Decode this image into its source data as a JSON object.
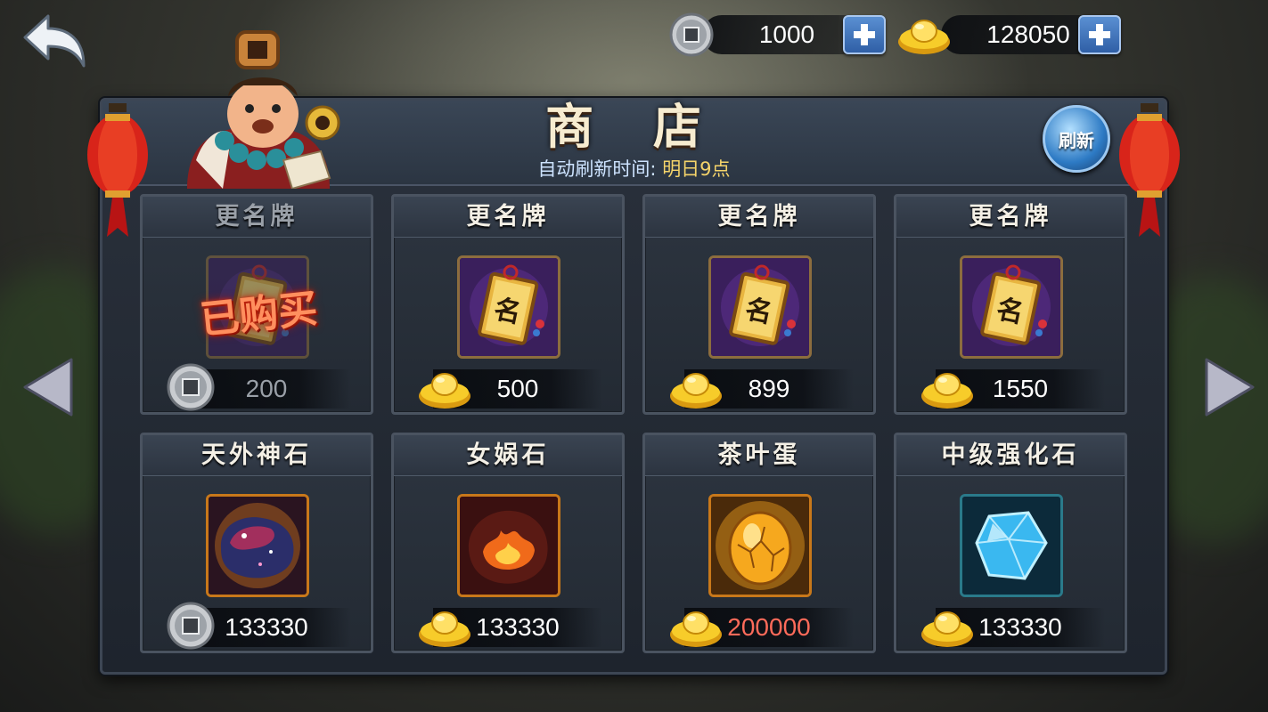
{
  "currency": {
    "coin": {
      "icon": "copper-coin-icon",
      "value": "1000"
    },
    "gold": {
      "icon": "gold-ingot-icon",
      "value": "128050"
    }
  },
  "shop": {
    "title": "商 店",
    "refresh_prefix": "自动刷新时间:",
    "refresh_time": "明日9点",
    "refresh_button": "刷新",
    "sold_label": "已购买"
  },
  "items": [
    {
      "name": "更名牌",
      "icon": "name-plate-icon",
      "currency": "coin",
      "price": "200",
      "sold": true
    },
    {
      "name": "更名牌",
      "icon": "name-plate-icon",
      "currency": "gold",
      "price": "500",
      "sold": false
    },
    {
      "name": "更名牌",
      "icon": "name-plate-icon",
      "currency": "gold",
      "price": "899",
      "sold": false
    },
    {
      "name": "更名牌",
      "icon": "name-plate-icon",
      "currency": "gold",
      "price": "1550",
      "sold": false
    },
    {
      "name": "天外神石",
      "icon": "meteorite-stone-icon",
      "currency": "coin",
      "price": "133330",
      "sold": false
    },
    {
      "name": "女娲石",
      "icon": "fire-stone-icon",
      "currency": "gold",
      "price": "133330",
      "sold": false
    },
    {
      "name": "茶叶蛋",
      "icon": "golden-egg-icon",
      "currency": "gold",
      "price": "200000",
      "sold": false,
      "price_color": "#ff6b5a"
    },
    {
      "name": "中级强化石",
      "icon": "blue-crystal-icon",
      "currency": "gold",
      "price": "133330",
      "sold": false
    }
  ],
  "colors": {
    "gold_text": "#f5d46a",
    "subtitle": "#cde3ff",
    "unaffordable": "#ff6b5a"
  }
}
